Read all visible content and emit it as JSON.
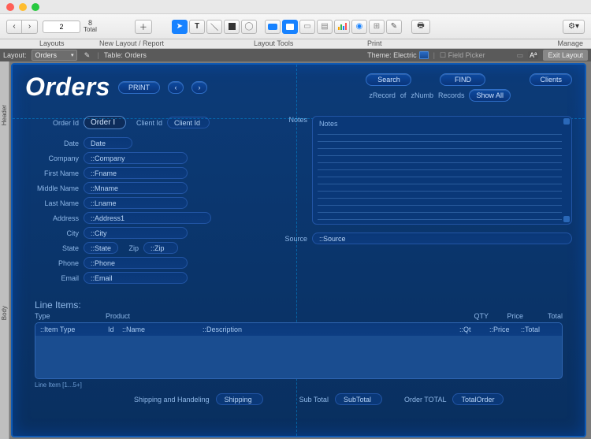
{
  "window": {
    "traffic": [
      "close",
      "min",
      "max"
    ]
  },
  "toolbar": {
    "nav_back": "←",
    "nav_fwd": "→",
    "page_current": "2",
    "page_total": "8",
    "total_label": "Total",
    "layouts_label": "Layouts",
    "new_layout_label": "New Layout / Report",
    "layout_tools_label": "Layout Tools",
    "print_label": "Print",
    "manage_label": "Manage"
  },
  "layoutbar": {
    "layout_label": "Layout:",
    "layout_value": "Orders",
    "table_label": "Table: Orders",
    "theme_label": "Theme: Electric",
    "field_picker": "Field Picker",
    "a_super": "Aª",
    "exit": "Exit Layout"
  },
  "side": {
    "header": "Header",
    "body": "Body"
  },
  "page": {
    "title": "Orders",
    "print_btn": "PRINT",
    "prev": "‹",
    "next": "›",
    "search_btn": "Search",
    "find_btn": "FIND",
    "clients_btn": "Clients",
    "zrecord": "zRecord",
    "of": "of",
    "znumb": "zNumb",
    "records": "Records",
    "show_all": "Show All"
  },
  "form": {
    "order_id_label": "Order Id",
    "order_id_field": "Order I",
    "client_id_label": "Client Id",
    "client_id_field": "Client Id",
    "date_label": "Date",
    "date_field": "Date",
    "company_label": "Company",
    "company_field": "::Company",
    "first_name_label": "First Name",
    "first_name_field": "::Fname",
    "middle_name_label": "Middle Name",
    "middle_name_field": "::Mname",
    "last_name_label": "Last Name",
    "last_name_field": "::Lname",
    "address_label": "Address",
    "address_field": "::Address1",
    "city_label": "City",
    "city_field": "::City",
    "state_label": "State",
    "state_field": "::State",
    "zip_label": "Zip",
    "zip_field": "::Zip",
    "phone_label": "Phone",
    "phone_field": "::Phone",
    "email_label": "Email",
    "email_field": "::Email",
    "notes_label": "Notes",
    "notes_field": "Notes",
    "source_label": "Source",
    "source_field": "::Source"
  },
  "lineitems": {
    "header": "Line Items:",
    "col_type": "Type",
    "col_product": "Product",
    "col_qty": "QTY",
    "col_price": "Price",
    "col_total": "Total",
    "row_type": "::Item Type",
    "row_id_label": "Id",
    "row_name": "::Name",
    "row_desc": "::Description",
    "row_qt": "::Qt",
    "row_price": "::Price",
    "row_total": "::Total",
    "after": "Line Item [1...5+]"
  },
  "totals": {
    "ship_label": "Shipping and Handeling",
    "ship_field": "Shipping",
    "subtotal_label": "Sub Total",
    "subtotal_field": "SubTotal",
    "ordertotal_label": "Order TOTAL",
    "ordertotal_field": "TotalOrder"
  }
}
